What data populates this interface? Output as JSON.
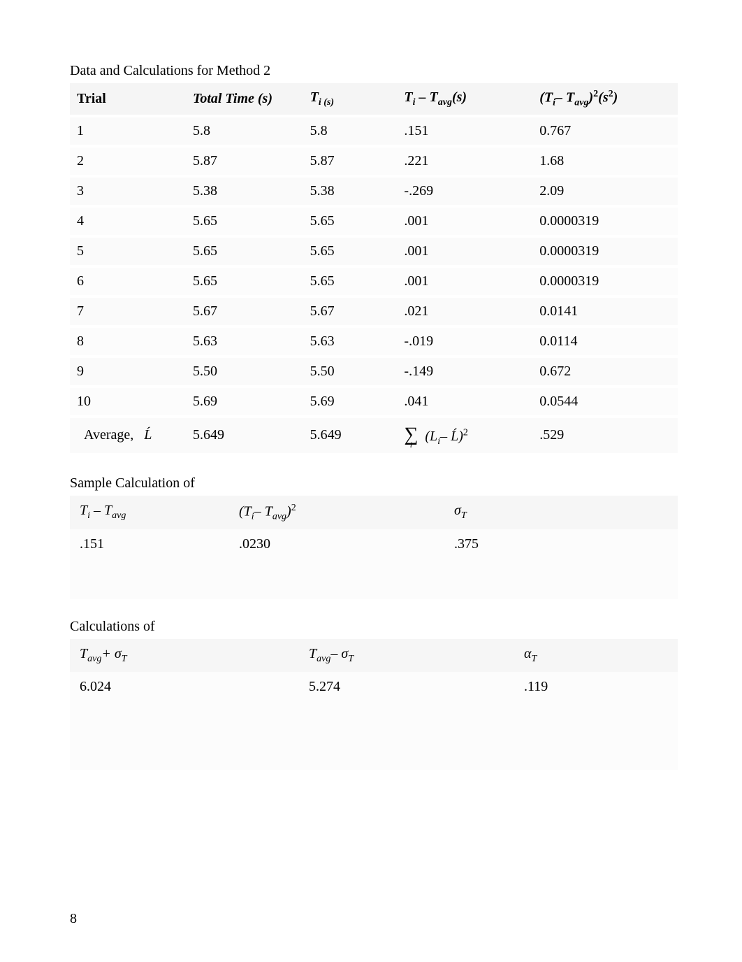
{
  "title1": "Data and Calculations for Method 2",
  "table1": {
    "headers": {
      "trial": "Trial",
      "totalTime": "Total Time (s)",
      "ti": "T",
      "ti_sub": "i (s)",
      "diff_pre": "T",
      "diff_sub1": "i",
      "diff_mid": " – T",
      "diff_sub2": "avg",
      "diff_post": "(s)",
      "sq_pre": "(T",
      "sq_sub1": "i",
      "sq_mid": "– T",
      "sq_sub2": "avg",
      "sq_post": ")",
      "sq_sup": "2",
      "sq_tail": "(s",
      "sq_tail_sup": "2",
      "sq_tail_close": ")"
    },
    "rows": [
      {
        "trial": "1",
        "totalTime": "5.8",
        "ti": "5.8",
        "diff": ".151",
        "sq": "0.767"
      },
      {
        "trial": "2",
        "totalTime": "5.87",
        "ti": "5.87",
        "diff": ".221",
        "sq": "1.68"
      },
      {
        "trial": "3",
        "totalTime": "5.38",
        "ti": "5.38",
        "diff": "-.269",
        "sq": "2.09"
      },
      {
        "trial": "4",
        "totalTime": "5.65",
        "ti": "5.65",
        "diff": ".001",
        "sq": "0.0000319"
      },
      {
        "trial": "5",
        "totalTime": "5.65",
        "ti": "5.65",
        "diff": ".001",
        "sq": "0.0000319"
      },
      {
        "trial": "6",
        "totalTime": "5.65",
        "ti": "5.65",
        "diff": ".001",
        "sq": "0.0000319"
      },
      {
        "trial": "7",
        "totalTime": "5.67",
        "ti": "5.67",
        "diff": ".021",
        "sq": "0.0141"
      },
      {
        "trial": "8",
        "totalTime": "5.63",
        "ti": "5.63",
        "diff": "-.019",
        "sq": "0.0114"
      },
      {
        "trial": "9",
        "totalTime": "5.50",
        "ti": "5.50",
        "diff": "-.149",
        "sq": "0.672"
      },
      {
        "trial": "10",
        "totalTime": "5.69",
        "ti": "5.69",
        "diff": ".041",
        "sq": "0.0544"
      }
    ],
    "avg": {
      "label_pre": "Average,",
      "label_sym": "Ĺ",
      "totalTime": "5.649",
      "ti": "5.649",
      "sum_sym": "∑",
      "sum_sub": "i",
      "sum_inner_pre": "(L",
      "sum_inner_sub": "i",
      "sum_inner_mid": "– Ĺ)",
      "sum_inner_sup": "2",
      "sq": ".529"
    }
  },
  "title2": "Sample Calculation of",
  "table2": {
    "headers": {
      "h1_pre": "T",
      "h1_sub1": "i",
      "h1_mid": " – T",
      "h1_sub2": "avg",
      "h2_pre": "(T",
      "h2_sub1": "i",
      "h2_mid": "– T",
      "h2_sub2": "avg",
      "h2_post": ")",
      "h2_sup": "2",
      "h3_sym": "σ",
      "h3_sub": "T"
    },
    "row": {
      "c1": ".151",
      "c2": ".0230",
      "c3": ".375"
    }
  },
  "title3": "Calculations of",
  "table3": {
    "headers": {
      "h1_pre": "T",
      "h1_sub": "avg",
      "h1_mid": "+ σ",
      "h1_sub2": "T",
      "h2_pre": "T",
      "h2_sub": "avg",
      "h2_mid": "– σ",
      "h2_sub2": "T",
      "h3_sym": "α",
      "h3_sub": "T"
    },
    "row": {
      "c1": "6.024",
      "c2": "5.274",
      "c3": ".119"
    }
  },
  "pageNumber": "8",
  "chart_data": {
    "type": "table",
    "title": "Data and Calculations for Method 2",
    "columns": [
      "Trial",
      "Total Time (s)",
      "T_i (s)",
      "T_i - T_avg (s)",
      "(T_i - T_avg)^2 (s^2)"
    ],
    "rows": [
      [
        "1",
        5.8,
        5.8,
        0.151,
        0.767
      ],
      [
        "2",
        5.87,
        5.87,
        0.221,
        1.68
      ],
      [
        "3",
        5.38,
        5.38,
        -0.269,
        2.09
      ],
      [
        "4",
        5.65,
        5.65,
        0.001,
        3.19e-05
      ],
      [
        "5",
        5.65,
        5.65,
        0.001,
        3.19e-05
      ],
      [
        "6",
        5.65,
        5.65,
        0.001,
        3.19e-05
      ],
      [
        "7",
        5.67,
        5.67,
        0.021,
        0.0141
      ],
      [
        "8",
        5.63,
        5.63,
        -0.019,
        0.0114
      ],
      [
        "9",
        5.5,
        5.5,
        -0.149,
        0.672
      ],
      [
        "10",
        5.69,
        5.69,
        0.041,
        0.0544
      ],
      [
        "Average, L_hat",
        5.649,
        5.649,
        "sum_i (L_i - L_hat)^2",
        0.529
      ]
    ],
    "sample_calculation": {
      "T_i - T_avg": 0.151,
      "(T_i - T_avg)^2": 0.023,
      "sigma_T": 0.375
    },
    "calculations": {
      "T_avg + sigma_T": 6.024,
      "T_avg - sigma_T": 5.274,
      "alpha_T": 0.119
    }
  }
}
